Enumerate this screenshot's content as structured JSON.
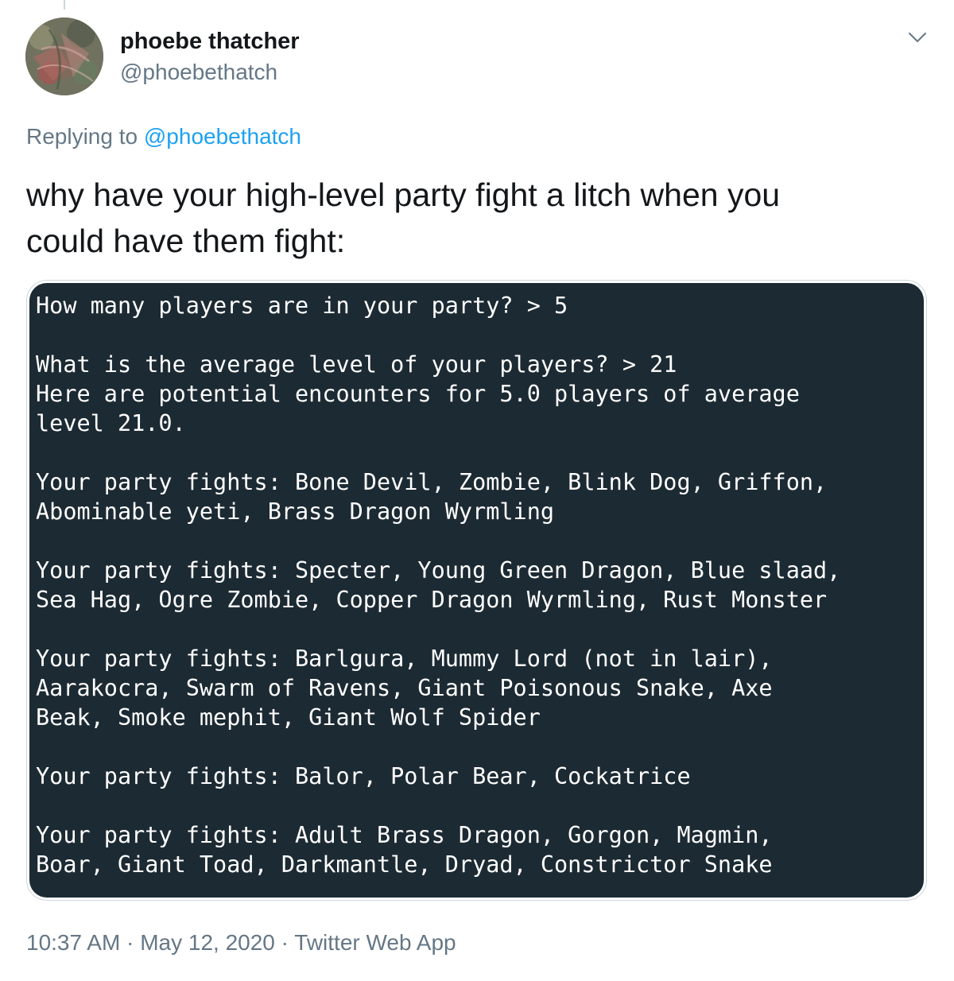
{
  "tweet": {
    "author": {
      "name": "phoebe thatcher",
      "handle": "@phoebethatch"
    },
    "replying_prefix": "Replying to",
    "replying_to": "@phoebethatch",
    "text_line1": "why have your high-level party fight a litch when you",
    "text_line2": "could have them fight:",
    "terminal_lines": [
      "How many players are in your party? > 5",
      "",
      "What is the average level of your players? > 21",
      "Here are potential encounters for 5.0 players of average",
      "level 21.0.",
      "",
      "Your party fights: Bone Devil, Zombie, Blink Dog, Griffon,",
      "Abominable yeti, Brass Dragon Wyrmling",
      "",
      "Your party fights: Specter, Young Green Dragon, Blue slaad,",
      "Sea Hag, Ogre Zombie, Copper Dragon Wyrmling, Rust Monster",
      "",
      "Your party fights: Barlgura, Mummy Lord (not in lair),",
      "Aarakocra, Swarm of Ravens, Giant Poisonous Snake, Axe",
      "Beak, Smoke mephit, Giant Wolf Spider",
      "",
      "Your party fights: Balor, Polar Bear, Cockatrice",
      "",
      "Your party fights: Adult Brass Dragon, Gorgon, Magmin,",
      "Boar, Giant Toad, Darkmantle, Dryad, Constrictor Snake"
    ],
    "time": "10:37 AM",
    "separator": " · ",
    "date": "May 12, 2020",
    "source": "Twitter Web App"
  },
  "icons": {
    "menu": "chevron-down-icon"
  },
  "colors": {
    "text_primary": "#14171a",
    "text_secondary": "#657786",
    "link": "#1da1f2",
    "terminal_bg": "#1c2a33",
    "terminal_text": "#ffffff",
    "border": "#ccd6dd"
  }
}
